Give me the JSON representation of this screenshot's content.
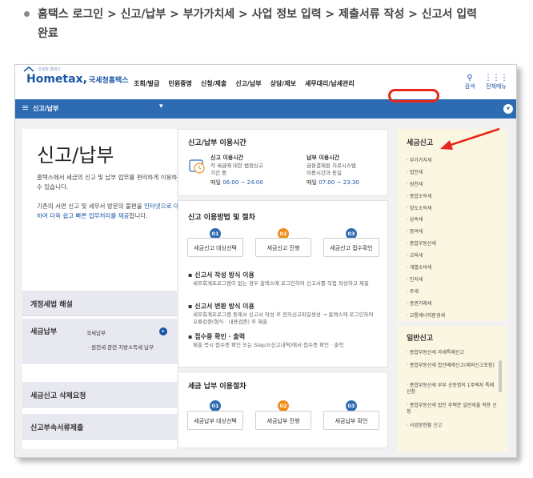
{
  "caption": {
    "line1": "홈택스 로그인 > 신고/납부 > 부가가치세 > 사업 정보 입력 > 제출서류 작성 > 신고서 입력",
    "line2": "완료"
  },
  "header": {
    "logo_small": "국세청 홈택스",
    "logo": "Hometax,",
    "logo_org": "국세청홈택스",
    "nav": [
      "조회/발급",
      "민원증명",
      "신청/제출",
      "신고/납부",
      "상담/제보",
      "세무대리/납세관리"
    ],
    "search_label": "검색",
    "all_menu_label": "전체메뉴"
  },
  "breadcrumb": {
    "label": "신고/납부"
  },
  "left": {
    "title": "신고/납부",
    "intro1": "홈택스에서 세금의 신고 및 납부 업무를 편리하게 이용하실 수 있습니다.",
    "intro2_prefix": "기존의 서면 신고 및 세무서 방문의 불편을",
    "intro2_link": "인터넷으로 대신하여 더욱 쉽고 빠른 업무처리를 제공",
    "intro2_suffix": "합니다.",
    "boxes": {
      "tax_law": "개정세법 해설",
      "tax_payment": "세금납부",
      "tax_payment_sub1": "국세납부",
      "tax_payment_sub2": "· 원천세 관련 지방소득세 납부",
      "delete_request": "세금신고 삭제요청",
      "attachments": "신고부속서류제출"
    }
  },
  "hours": {
    "title": "신고/납부 이용시간",
    "report_title": "신고 이용시간",
    "report_desc1": "각 세금에 대한 법정신고",
    "report_desc2": "기간 중",
    "report_daily_label": "매일",
    "report_time": "06:00 ~ 24:00",
    "pay_title": "납부 이용시간",
    "pay_desc1": "금융결제원 지로시스템",
    "pay_desc2": "이용시간과 동일",
    "pay_daily_label": "매일",
    "pay_time": "07:00 ~ 23:30"
  },
  "procedure": {
    "title": "신고 이용방법 및 절차",
    "steps": [
      {
        "num": "01",
        "label": "세금신고 대상선택",
        "color": "#2d6bb3"
      },
      {
        "num": "02",
        "label": "세금신고 진행",
        "color": "#f08c1c"
      },
      {
        "num": "03",
        "label": "세금신고 접수확인",
        "color": "#2d6bb3"
      }
    ],
    "info": [
      {
        "title": "신고서 작성 방식 이용",
        "desc": "세무회계프로그램이 없는 경우 홈택스에 로그인하여 신고서를 직접 작성하고 제출"
      },
      {
        "title": "신고서 변환 방식 이용",
        "desc": "세무회계프로그램 등에서 신고서 작성 후 전자신고파일생성 → 홈택스에 로그인하여 오류검증(형식 · 내용검증) 후 제출"
      },
      {
        "title": "접수증 확인 · 출력",
        "desc": "제출 즉시 접수증 확인 또는 Step3(신고내역)에서 접수증 확인 · 출력"
      }
    ]
  },
  "payment": {
    "title": "세금 납부 이용절차",
    "steps": [
      {
        "num": "01",
        "label": "세금납부 대상선택",
        "color": "#2d6bb3"
      },
      {
        "num": "02",
        "label": "세금납부 진행",
        "color": "#f08c1c"
      },
      {
        "num": "03",
        "label": "세금납부 확인",
        "color": "#2d6bb3"
      }
    ]
  },
  "tax_report": {
    "title": "세금신고",
    "items": [
      "부가가치세",
      "법인세",
      "원천세",
      "종합소득세",
      "양도소득세",
      "상속세",
      "증여세",
      "종합부동산세",
      "교육세",
      "개별소비세",
      "인지세",
      "주세",
      "증권거래세",
      "교통에너지환경세"
    ]
  },
  "general_report": {
    "title": "일반신고",
    "items": [
      "종합부동산세 과세특례신고",
      "종합부동산세 합산배제신고(제외신고포함)",
      "종합부동산세 부부 공동명의 1주택자 특례 신청",
      "종합부동산세 법인 주택분 일반세율 적용 신청",
      "사업장현황 신고"
    ]
  },
  "colors": {
    "brand_blue": "#2d6bb3",
    "accent_orange": "#f08c1c",
    "annotation_red": "#e8271c"
  }
}
